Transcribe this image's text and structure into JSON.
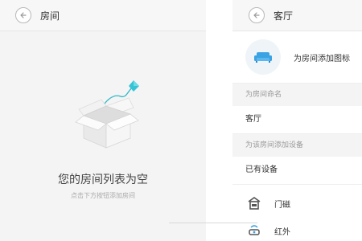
{
  "left": {
    "header_title": "房间",
    "empty_title": "您的房间列表为空",
    "empty_subtitle": "点击下方按钮添加房间"
  },
  "right": {
    "header_title": "客厅",
    "add_icon_label": "为房间添加图标",
    "name_section_label": "为房间命名",
    "room_name": "客厅",
    "device_section_label": "为该房间添加设备",
    "existing_devices_label": "已有设备",
    "devices": [
      {
        "label": "门磁",
        "icon": "door-sensor-icon"
      },
      {
        "label": "红外",
        "icon": "infrared-icon"
      }
    ]
  },
  "colors": {
    "accent": "#3aa3e3",
    "kite": "#3bc3d3"
  }
}
